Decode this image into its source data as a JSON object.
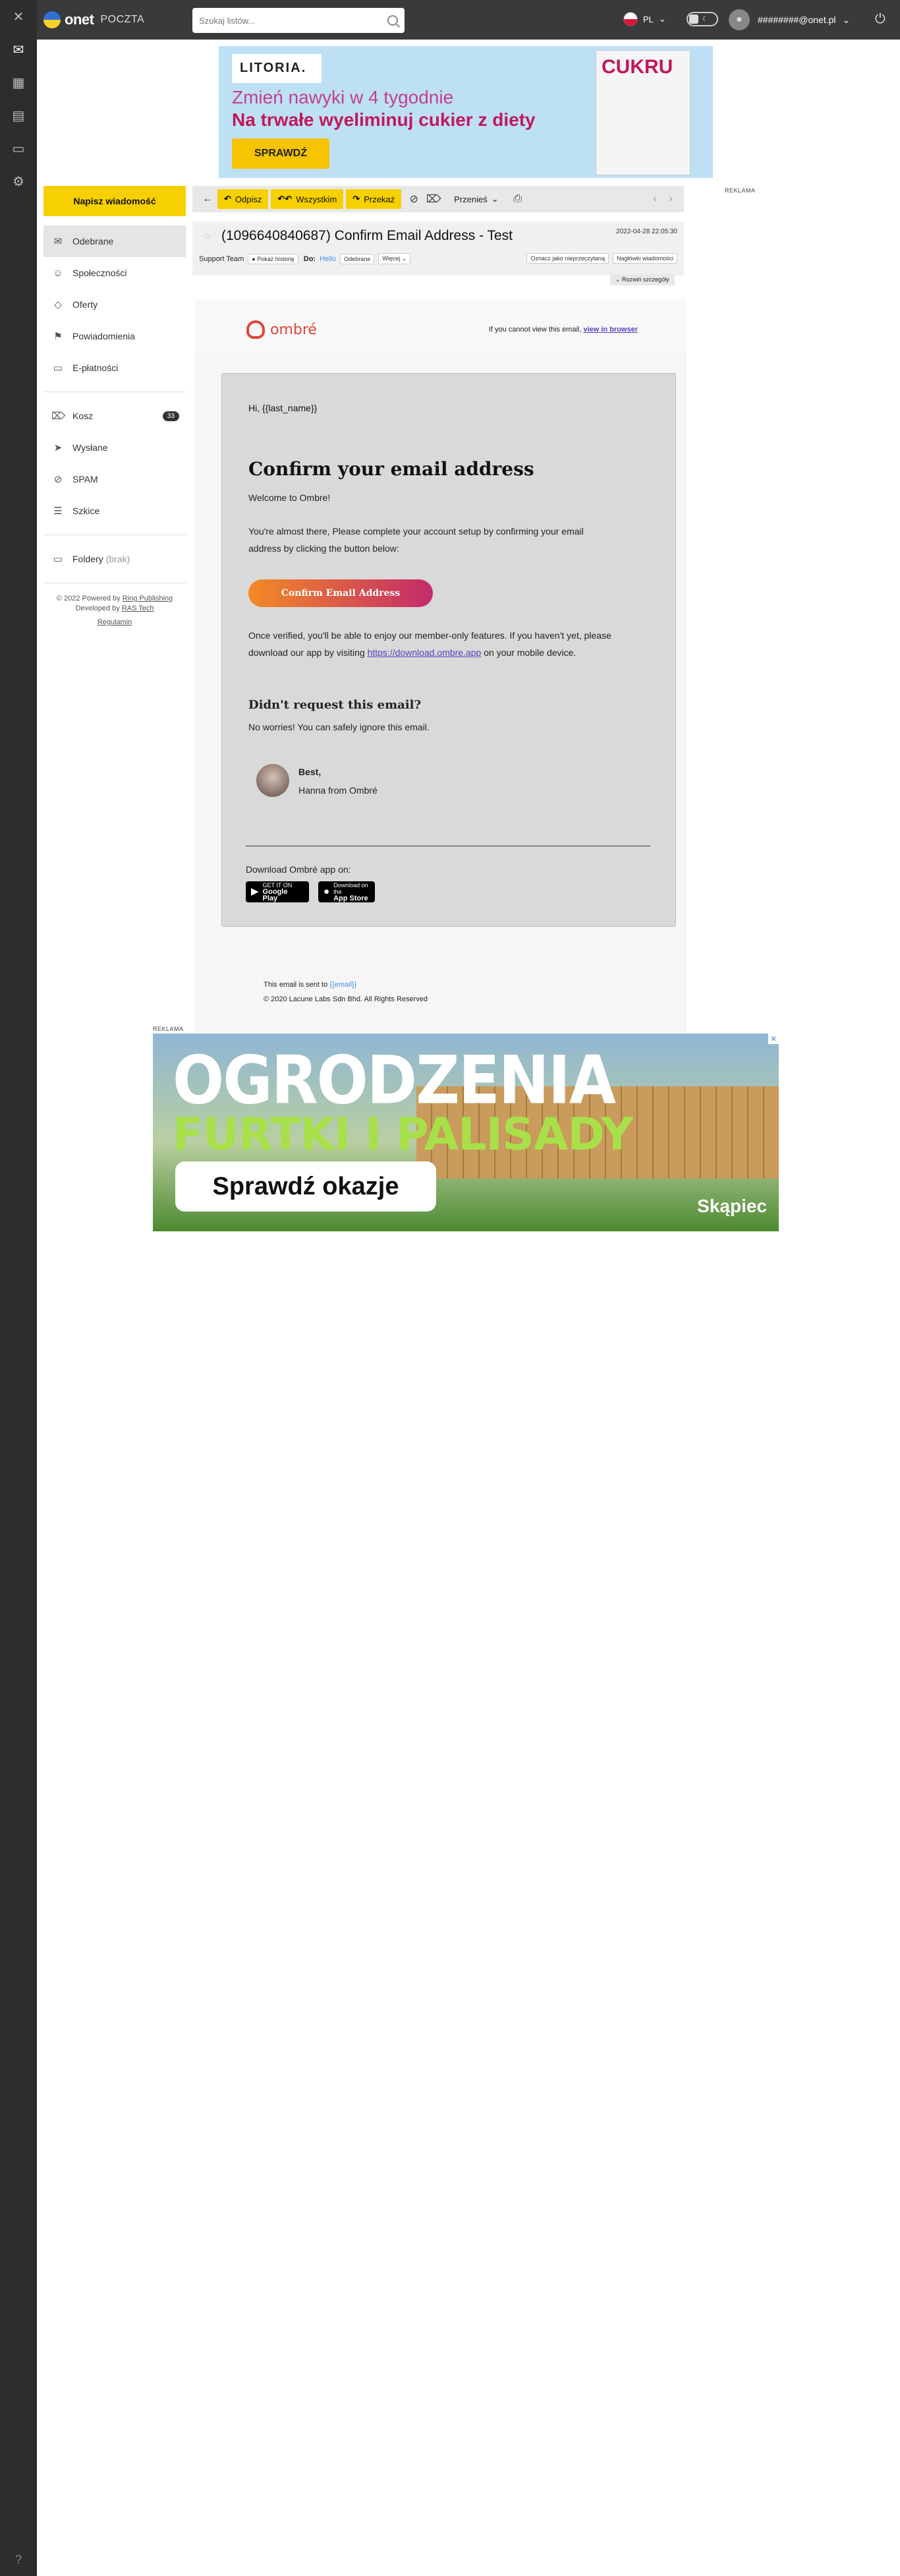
{
  "topbar": {
    "logo_text": "onet",
    "logo_sub": "POCZTA",
    "search_placeholder": "Szukaj listów...",
    "lang": "PL",
    "toggle_label": "☾",
    "user_email": "########@onet.pl"
  },
  "rail": {
    "icons": [
      "close-icon",
      "mail-icon",
      "calendar-icon",
      "contacts-icon",
      "folder-icon",
      "settings-icon"
    ],
    "help": "?"
  },
  "ad_top": {
    "brand": "LITORIA.",
    "line1": "Zmień nawyki w 4 tygodnie",
    "line2": "Na trwałe wyeliminuj cukier z diety",
    "cta": "SPRAWDŹ",
    "book_title": "CUKRU",
    "label": "REKLAMA"
  },
  "nav": {
    "compose": "Napisz wiadomość",
    "items": [
      {
        "label": "Odebrane",
        "icon": "✉"
      },
      {
        "label": "Społeczności",
        "icon": "☺"
      },
      {
        "label": "Oferty",
        "icon": "◇"
      },
      {
        "label": "Powiadomienia",
        "icon": "⚑"
      },
      {
        "label": "E-płatności",
        "icon": "▭"
      }
    ],
    "items2": [
      {
        "label": "Kosz",
        "icon": "⌦",
        "count": "33"
      },
      {
        "label": "Wysłane",
        "icon": "➤"
      },
      {
        "label": "SPAM",
        "icon": "⊘"
      },
      {
        "label": "Szkice",
        "icon": "☰"
      }
    ],
    "folders_label": "Foldery",
    "folders_muted": "(brak)",
    "footer_line1": "© 2022 Powered by",
    "footer_link1": "Ring Publishing",
    "footer_line2": "Developed by",
    "footer_link2": "RAS Tech",
    "footer_link3": "Regulamin"
  },
  "toolbar": {
    "back": "←",
    "reply": "Odpisz",
    "reply_all": "Wszystkim",
    "forward": "Przekaż",
    "block": "⊘",
    "trash": "⌦",
    "move": "Przenieś",
    "print": "⎙",
    "prev": "‹",
    "next": "›"
  },
  "message": {
    "subject": "(1096640840687) Confirm Email Address - Test",
    "date": "2022-04-28 22:05:30",
    "from": "Support Team",
    "show_history": "Pokaż historię",
    "to_label": "Do:",
    "to_value": "Hello",
    "folder_pill": "Odebrane",
    "more_pill": "Więcej",
    "mark_unread": "Oznacz jako nieprzeczytaną",
    "headers": "Nagłówki wiadomości",
    "expand": "Rozwiń szczegóły"
  },
  "email": {
    "brand": "ombré",
    "view_prefix": "If you cannot view this email,",
    "view_link": "view in browser",
    "greeting": "Hi, {{last_name}}",
    "heading": "Confirm your email address",
    "welcome": "Welcome to Ombre!",
    "para1": "You're almost there, Please complete your account setup by confirming your email address by clicking the button below:",
    "button": "Confirm Email Address",
    "para2_a": "Once verified, you'll be able to enjoy our member-only features. If you haven't yet, please download our app by visiting",
    "para2_link": "https://download.ombre.app",
    "para2_b": "on your mobile device.",
    "h3": "Didn't request this email?",
    "para3": "No worries! You can safely ignore this email.",
    "sig_best": "Best,",
    "sig_name": "Hanna from Ombré",
    "download": "Download Ombré app on:",
    "google_small": "GET IT ON",
    "google_big": "Google Play",
    "apple_small": "Download on the",
    "apple_big": "App Store",
    "foot1_prefix": "This email is sent to",
    "foot1_tpl": "{{email}}",
    "foot2": "© 2020 Lacune Labs Sdn Bhd. All Rights Reserved"
  },
  "ad_bottom": {
    "label": "REKLAMA",
    "t1": "OGRODZENIA",
    "t2": "FURTKI I PALISADY",
    "cta": "Sprawdź okazje",
    "brand": "Skąpiec",
    "close": "✕"
  }
}
